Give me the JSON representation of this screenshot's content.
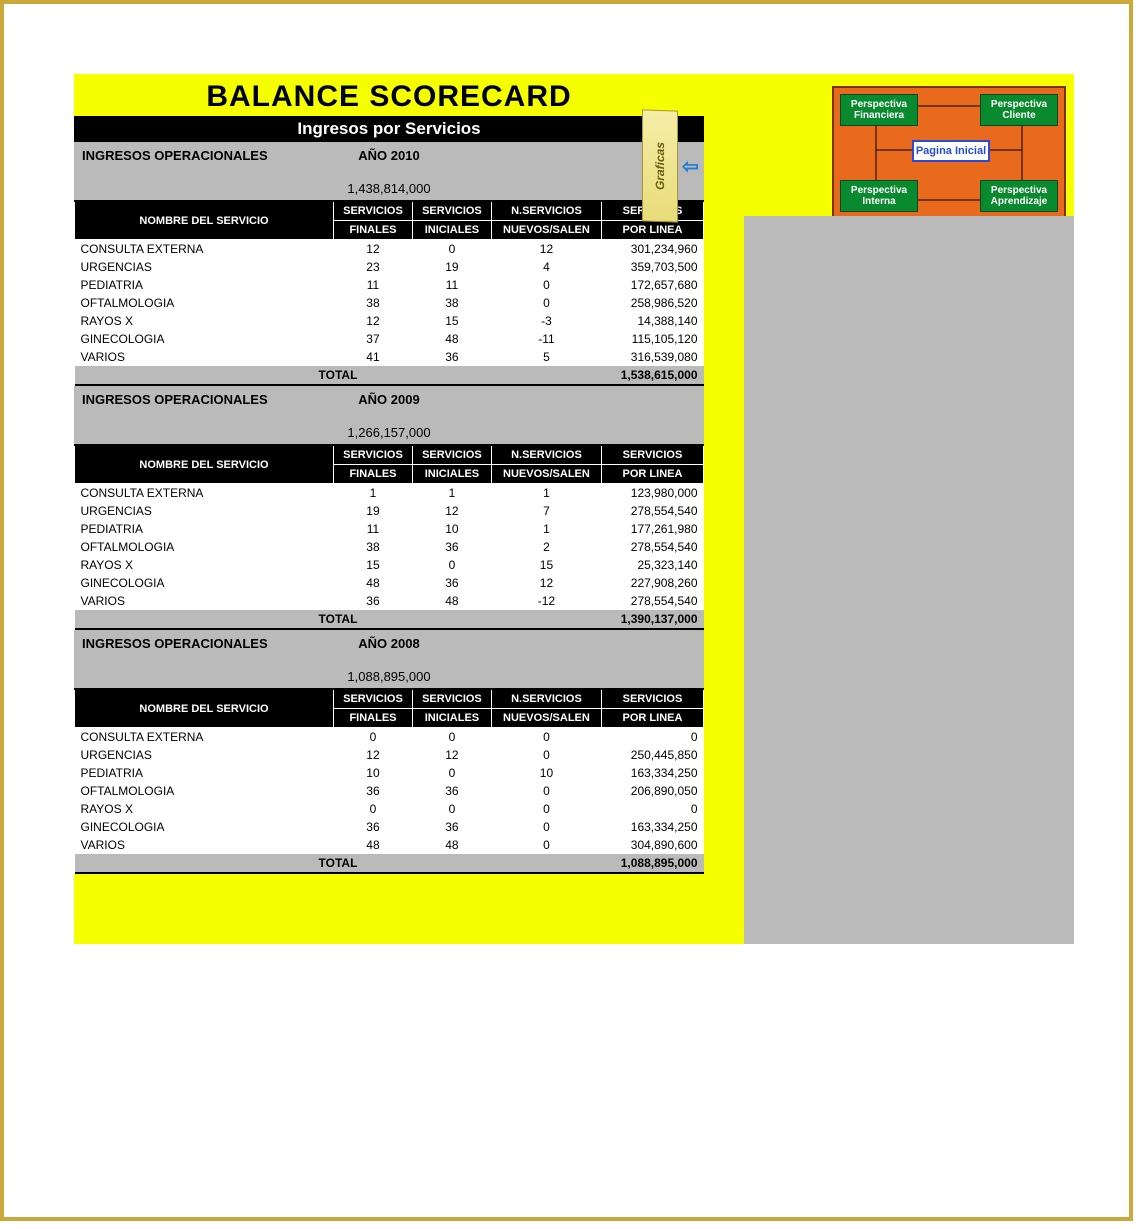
{
  "title": "BALANCE SCORECARD",
  "subtitle": "Ingresos por Servicios",
  "section_label": "INGRESOS OPERACIONALES",
  "headers": {
    "name": "NOMBRE DEL SERVICIO",
    "finales_top": "SERVICIOS",
    "finales_sub": "FINALES",
    "iniciales_top": "SERVICIOS",
    "iniciales_sub": "INICIALES",
    "nuevos_top": "N.SERVICIOS",
    "nuevos_sub": "NUEVOS/SALEN",
    "linea_top": "SERVICIOS",
    "linea_sub": "POR LINEA"
  },
  "total_label": "TOTAL",
  "sections": [
    {
      "year": "AÑO 2010",
      "amount": "1,438,814,000",
      "rows": [
        {
          "name": "CONSULTA EXTERNA",
          "finales": "12",
          "iniciales": "0",
          "nuevos": "12",
          "linea": "301,234,960"
        },
        {
          "name": "URGENCIAS",
          "finales": "23",
          "iniciales": "19",
          "nuevos": "4",
          "linea": "359,703,500"
        },
        {
          "name": "PEDIATRIA",
          "finales": "11",
          "iniciales": "11",
          "nuevos": "0",
          "linea": "172,657,680"
        },
        {
          "name": "OFTALMOLOGIA",
          "finales": "38",
          "iniciales": "38",
          "nuevos": "0",
          "linea": "258,986,520"
        },
        {
          "name": "RAYOS X",
          "finales": "12",
          "iniciales": "15",
          "nuevos": "-3",
          "linea": "14,388,140"
        },
        {
          "name": "GINECOLOGIA",
          "finales": "37",
          "iniciales": "48",
          "nuevos": "-11",
          "linea": "115,105,120"
        },
        {
          "name": "VARIOS",
          "finales": "41",
          "iniciales": "36",
          "nuevos": "5",
          "linea": "316,539,080"
        }
      ],
      "total": "1,538,615,000"
    },
    {
      "year": "AÑO 2009",
      "amount": "1,266,157,000",
      "rows": [
        {
          "name": "CONSULTA EXTERNA",
          "finales": "1",
          "iniciales": "1",
          "nuevos": "1",
          "linea": "123,980,000"
        },
        {
          "name": "URGENCIAS",
          "finales": "19",
          "iniciales": "12",
          "nuevos": "7",
          "linea": "278,554,540"
        },
        {
          "name": "PEDIATRIA",
          "finales": "11",
          "iniciales": "10",
          "nuevos": "1",
          "linea": "177,261,980"
        },
        {
          "name": "OFTALMOLOGIA",
          "finales": "38",
          "iniciales": "36",
          "nuevos": "2",
          "linea": "278,554,540"
        },
        {
          "name": "RAYOS X",
          "finales": "15",
          "iniciales": "0",
          "nuevos": "15",
          "linea": "25,323,140"
        },
        {
          "name": "GINECOLOGIA",
          "finales": "48",
          "iniciales": "36",
          "nuevos": "12",
          "linea": "227,908,260"
        },
        {
          "name": "VARIOS",
          "finales": "36",
          "iniciales": "48",
          "nuevos": "-12",
          "linea": "278,554,540"
        }
      ],
      "total": "1,390,137,000"
    },
    {
      "year": "AÑO 2008",
      "amount": "1,088,895,000",
      "rows": [
        {
          "name": "CONSULTA EXTERNA",
          "finales": "0",
          "iniciales": "0",
          "nuevos": "0",
          "linea": "0"
        },
        {
          "name": "URGENCIAS",
          "finales": "12",
          "iniciales": "12",
          "nuevos": "0",
          "linea": "250,445,850"
        },
        {
          "name": "PEDIATRIA",
          "finales": "10",
          "iniciales": "0",
          "nuevos": "10",
          "linea": "163,334,250"
        },
        {
          "name": "OFTALMOLOGIA",
          "finales": "36",
          "iniciales": "36",
          "nuevos": "0",
          "linea": "206,890,050"
        },
        {
          "name": "RAYOS X",
          "finales": "0",
          "iniciales": "0",
          "nuevos": "0",
          "linea": "0"
        },
        {
          "name": "GINECOLOGIA",
          "finales": "36",
          "iniciales": "36",
          "nuevos": "0",
          "linea": "163,334,250"
        },
        {
          "name": "VARIOS",
          "finales": "48",
          "iniciales": "48",
          "nuevos": "0",
          "linea": "304,890,600"
        }
      ],
      "total": "1,088,895,000"
    }
  ],
  "nav": {
    "graficas": "Graficas",
    "financiera": "Perspectiva Financiera",
    "cliente": "Perspectiva Cliente",
    "interna": "Perspectiva Interna",
    "aprendizaje": "Perspectiva Aprendizaje",
    "home": "Pagina Inicial"
  }
}
